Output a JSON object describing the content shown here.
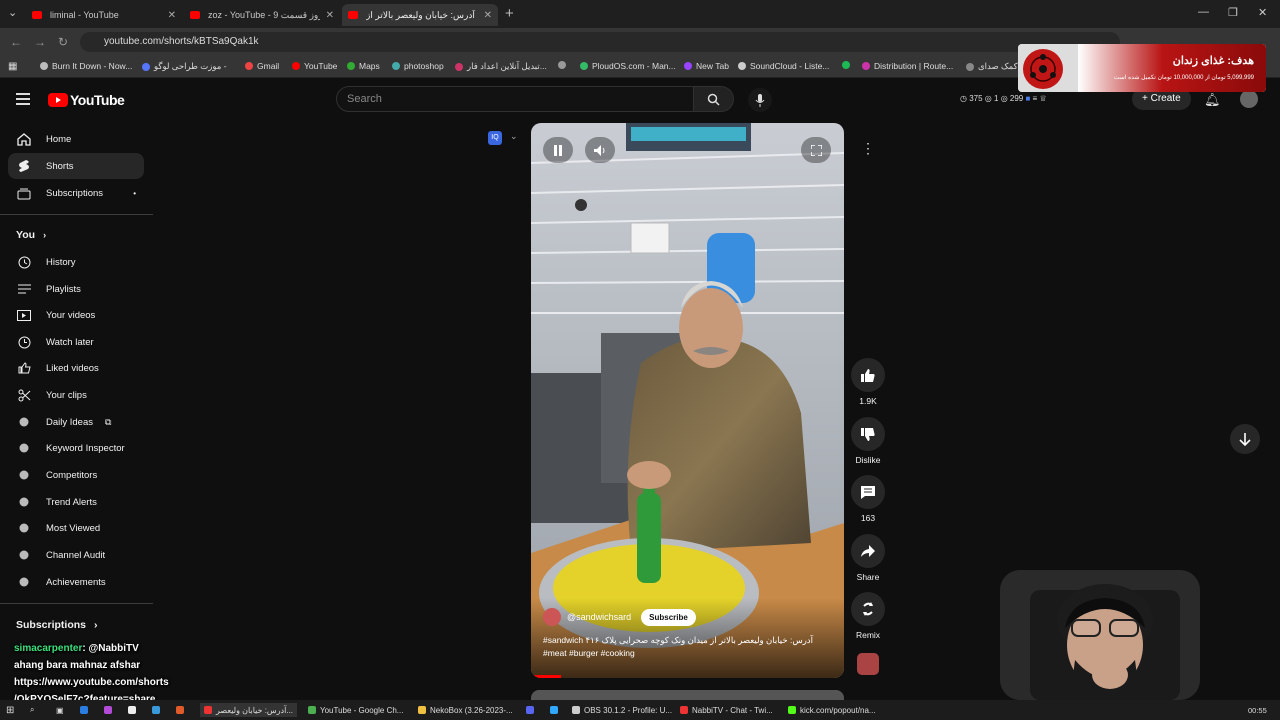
{
  "browser": {
    "tabs": [
      {
        "label": "liminal - YouTube",
        "active": false
      },
      {
        "label": "zoz - YouTube - 9 زن روز قسمت",
        "active": false
      },
      {
        "label": "آدرس: خیابان ولیعصر بالاتر از",
        "active": true
      }
    ],
    "url": "youtube.com/shorts/kBTSa9Qak1k",
    "bookmarks": [
      "Burn It Down - Now...",
      "موزت طراحی لوگو -",
      "Gmail",
      "YouTube",
      "Maps",
      "photoshop",
      "تبدیل آنلاین اعداد فار...",
      "",
      "PloudOS.com - Man...",
      "New Tab",
      "SoundCloud - Liste...",
      "",
      "Distribution | Route...",
      "کمک صدای..."
    ]
  },
  "header": {
    "logo_text": "YouTube",
    "search_placeholder": "Search",
    "stats": {
      "a": "375",
      "b": "1",
      "c": "299"
    },
    "create_label": "Create"
  },
  "sidebar": {
    "main": [
      {
        "label": "Home",
        "icon": "home-icon"
      },
      {
        "label": "Shorts",
        "icon": "shorts-icon",
        "active": true
      },
      {
        "label": "Subscriptions",
        "icon": "subscriptions-icon"
      }
    ],
    "you_label": "You",
    "you_items": [
      {
        "label": "History",
        "icon": "history-icon"
      },
      {
        "label": "Playlists",
        "icon": "playlists-icon"
      },
      {
        "label": "Your videos",
        "icon": "your-videos-icon"
      },
      {
        "label": "Watch later",
        "icon": "watch-later-icon"
      },
      {
        "label": "Liked videos",
        "icon": "liked-videos-icon"
      },
      {
        "label": "Your clips",
        "icon": "clips-icon"
      }
    ],
    "ext_items": [
      "Daily Ideas",
      "Keyword Inspector",
      "Competitors",
      "Trend Alerts",
      "Most Viewed",
      "Channel Audit",
      "Achievements"
    ],
    "subscriptions_label": "Subscriptions"
  },
  "short": {
    "channel": "@sandwichsard",
    "subscribe_label": "Subscribe",
    "caption_line1": "#sandwich آدرس: خیابان ولیعصر بالاتر از میدان ونک کوچه صحرایی پلاک ۴۱۶",
    "caption_line2": "#meat #burger #cooking"
  },
  "actions": {
    "likes": "1.9K",
    "dislike_label": "Dislike",
    "comments": "163",
    "share_label": "Share",
    "remix_label": "Remix"
  },
  "donation": {
    "title": "هدف: غذای زندان",
    "subtitle": "5,099,999 تومان از 10,000,000 تومان تکمیل شده است"
  },
  "chat": {
    "user": "simacarpenter",
    "mention": ": @NabbiTV",
    "line2": "ahang bara mahnaz afshar",
    "line3": "https://www.youtube.com/shorts",
    "line4": "/QkPYQSelF7c?feature=share"
  },
  "taskbar": {
    "items": [
      "آدرس: خیابان ولیعصر...",
      "YouTube - Google Ch...",
      "NekoBox (3.26-2023-...",
      "OBS 30.1.2 - Profile: U...",
      "NabbiTV - Chat - Twi...",
      "kick.com/popout/na..."
    ],
    "clock": "00:55"
  }
}
